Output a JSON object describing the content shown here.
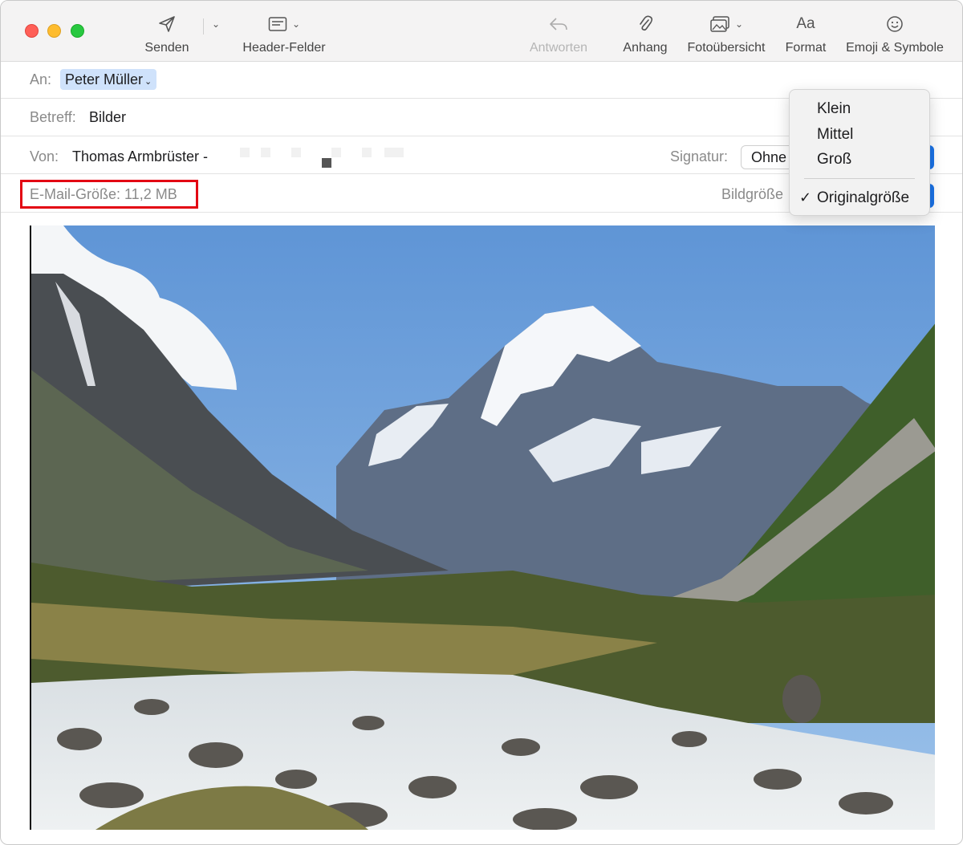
{
  "toolbar": {
    "send": "Senden",
    "header_fields": "Header-Felder",
    "reply": "Antworten",
    "attachment": "Anhang",
    "photo_browser": "Fotoübersicht",
    "format": "Format",
    "format_icon_text": "Aa",
    "emoji": "Emoji & Symbole"
  },
  "compose": {
    "to_label": "An:",
    "to_value": "Peter Müller",
    "subject_label": "Betreff:",
    "subject_value": "Bilder",
    "from_label": "Von:",
    "from_value": "Thomas Armbrüster -",
    "signature_label": "Signatur:",
    "signature_value": "Ohne",
    "email_size": "E-Mail-Größe: 11,2 MB",
    "image_size_label": "Bildgröße"
  },
  "image_size_menu": {
    "items": [
      "Klein",
      "Mittel",
      "Groß",
      "Originalgröße"
    ],
    "selected": "Originalgröße",
    "check": "✓"
  },
  "colors": {
    "highlight": "#e30613",
    "accent": "#1a73e8",
    "token": "#cfe2fb"
  }
}
